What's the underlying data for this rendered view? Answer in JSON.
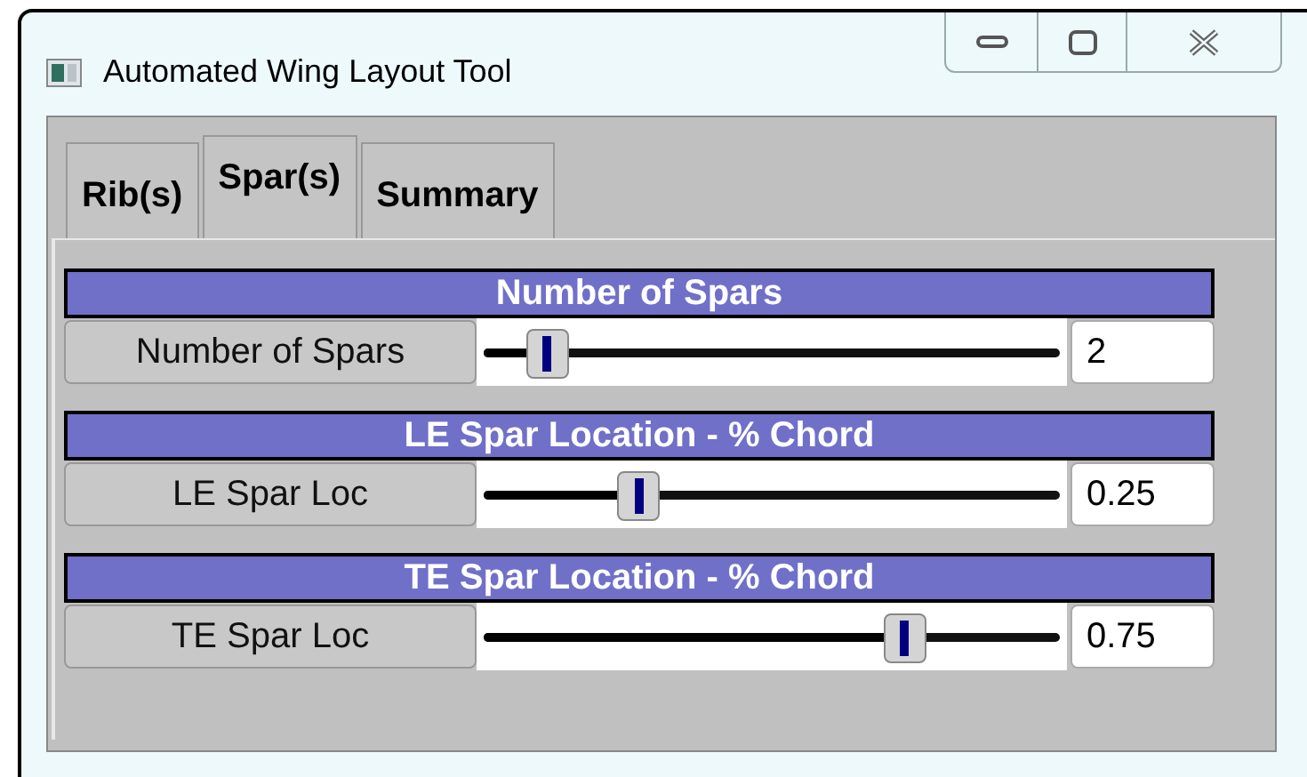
{
  "window": {
    "title": "Automated Wing Layout Tool"
  },
  "tabs": [
    {
      "label": "Rib(s)",
      "selected": false
    },
    {
      "label": "Spar(s)",
      "selected": true
    },
    {
      "label": "Summary",
      "selected": false
    }
  ],
  "sections": [
    {
      "heading": "Number of Spars",
      "button": "Number of Spars",
      "level": 0.11,
      "value": "2"
    },
    {
      "heading": "LE Spar Location - % Chord",
      "button": "LE Spar Loc",
      "level": 0.27,
      "value": "0.25"
    },
    {
      "heading": "TE Spar Location - % Chord",
      "button": "TE Spar Loc",
      "level": 0.73,
      "value": "0.75"
    }
  ]
}
